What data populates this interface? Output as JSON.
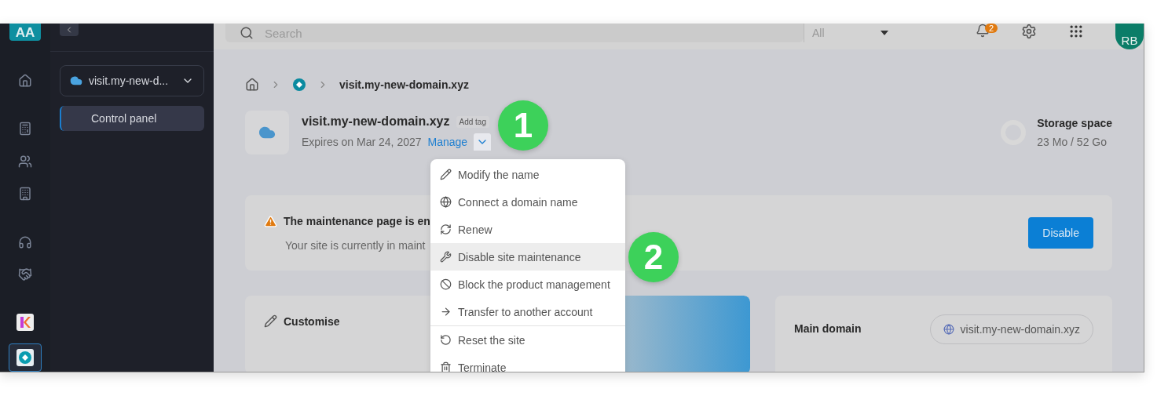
{
  "rail": {
    "initials": "AA",
    "apps": [
      {
        "selected": false
      },
      {
        "selected": true
      }
    ]
  },
  "site_selector": {
    "label": "visit.my-new-d..."
  },
  "nav": [
    {
      "label": "Control panel",
      "selected": true
    }
  ],
  "topbar": {
    "search_placeholder": "Search",
    "filter": "All",
    "notifications": "2",
    "avatar": "RB"
  },
  "breadcrumb": {
    "current": "visit.my-new-domain.xyz"
  },
  "product": {
    "name": "visit.my-new-domain.xyz",
    "tag": "Add tag",
    "expires": "Expires on Mar 24, 2027",
    "manage": "Manage"
  },
  "storage": {
    "title": "Storage space",
    "value": "23 Mo / 52 Go"
  },
  "alert": {
    "title": "The maintenance page is en",
    "text": "Your site is currently in maint",
    "button": "Disable"
  },
  "menu": [
    {
      "label": "Modify the name",
      "selected": false,
      "divider_before": false
    },
    {
      "label": "Connect a domain name",
      "selected": false,
      "divider_before": false
    },
    {
      "label": "Renew",
      "selected": false,
      "divider_before": false
    },
    {
      "label": "Disable site maintenance",
      "selected": true,
      "divider_before": false
    },
    {
      "label": "Block the product management",
      "selected": false,
      "divider_before": false
    },
    {
      "label": "Transfer to another account",
      "selected": false,
      "divider_before": false
    },
    {
      "label": "Reset the site",
      "selected": false,
      "divider_before": true
    },
    {
      "label": "Terminate",
      "selected": false,
      "divider_before": false
    }
  ],
  "customise": {
    "title": "Customise"
  },
  "main_domain": {
    "label": "Main domain",
    "value": "visit.my-new-domain.xyz"
  },
  "callouts": [
    "1",
    "2"
  ]
}
